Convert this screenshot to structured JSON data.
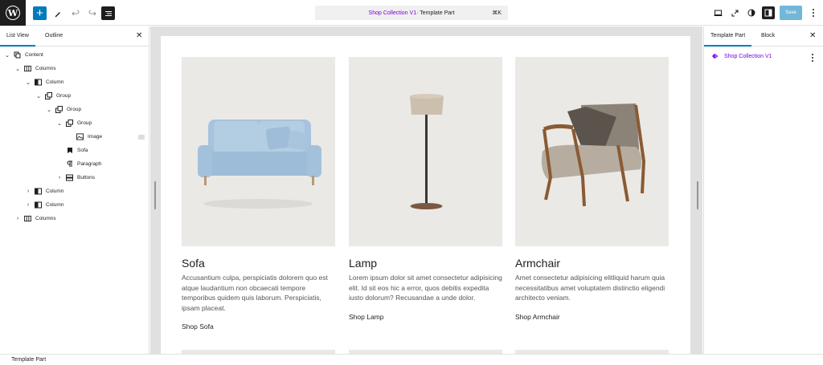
{
  "toolbar": {
    "logo_letter": "W",
    "add_label": "+",
    "command_title": "Shop Collection V1",
    "command_separator": " · Template Part",
    "command_shortcut": "⌘K",
    "save_label": "Save"
  },
  "left_panel": {
    "tabs": [
      "List View",
      "Outline"
    ],
    "tree": [
      {
        "label": "Content",
        "chev": "⌄",
        "icon": "template-part-icon"
      },
      {
        "label": "Columns",
        "chev": "⌄",
        "icon": "columns-icon"
      },
      {
        "label": "Column",
        "chev": "⌄",
        "icon": "column-icon"
      },
      {
        "label": "Group",
        "chev": "⌄",
        "icon": "group-icon"
      },
      {
        "label": "Group",
        "chev": "⌄",
        "icon": "group-icon"
      },
      {
        "label": "Group",
        "chev": "⌄",
        "icon": "group-icon"
      },
      {
        "label": "Image",
        "chev": "",
        "icon": "image-icon"
      },
      {
        "label": "Sofa",
        "chev": "",
        "icon": "bookmark-icon"
      },
      {
        "label": "Paragraph",
        "chev": "",
        "icon": "paragraph-icon"
      },
      {
        "label": "Buttons",
        "chev": "›",
        "icon": "buttons-icon"
      },
      {
        "label": "Column",
        "chev": "›",
        "icon": "column-icon"
      },
      {
        "label": "Column",
        "chev": "›",
        "icon": "column-icon"
      },
      {
        "label": "Columns",
        "chev": "›",
        "icon": "columns-icon"
      }
    ]
  },
  "cards": [
    {
      "title": "Sofa",
      "description": "Accusantium culpa, perspiciatis dolorem quo est atque laudantium non obcaecati tempore temporibus quidem quis laborum. Perspiciatis, ipsam placeat.",
      "link": "Shop Sofa"
    },
    {
      "title": "Lamp",
      "description": "Lorem ipsum dolor sit amet consectetur adipisicing elit. Id sit eos hic a error, quos debitis expedita iusto dolorum? Recusandae a unde dolor.",
      "link": "Shop Lamp"
    },
    {
      "title": "Armchair",
      "description": "Amet consectetur adipisicing elitliquid harum quia necessitatibus amet voluptatem distinctio eligendi architecto veniam.",
      "link": "Shop Armchair"
    }
  ],
  "right_panel": {
    "tabs": [
      "Template Part",
      "Block"
    ],
    "template_part_name": "Shop Collection V1"
  },
  "footer": {
    "breadcrumb": "Template Part"
  },
  "colors": {
    "accent": "#007cba",
    "template_part": "#7a00df"
  }
}
